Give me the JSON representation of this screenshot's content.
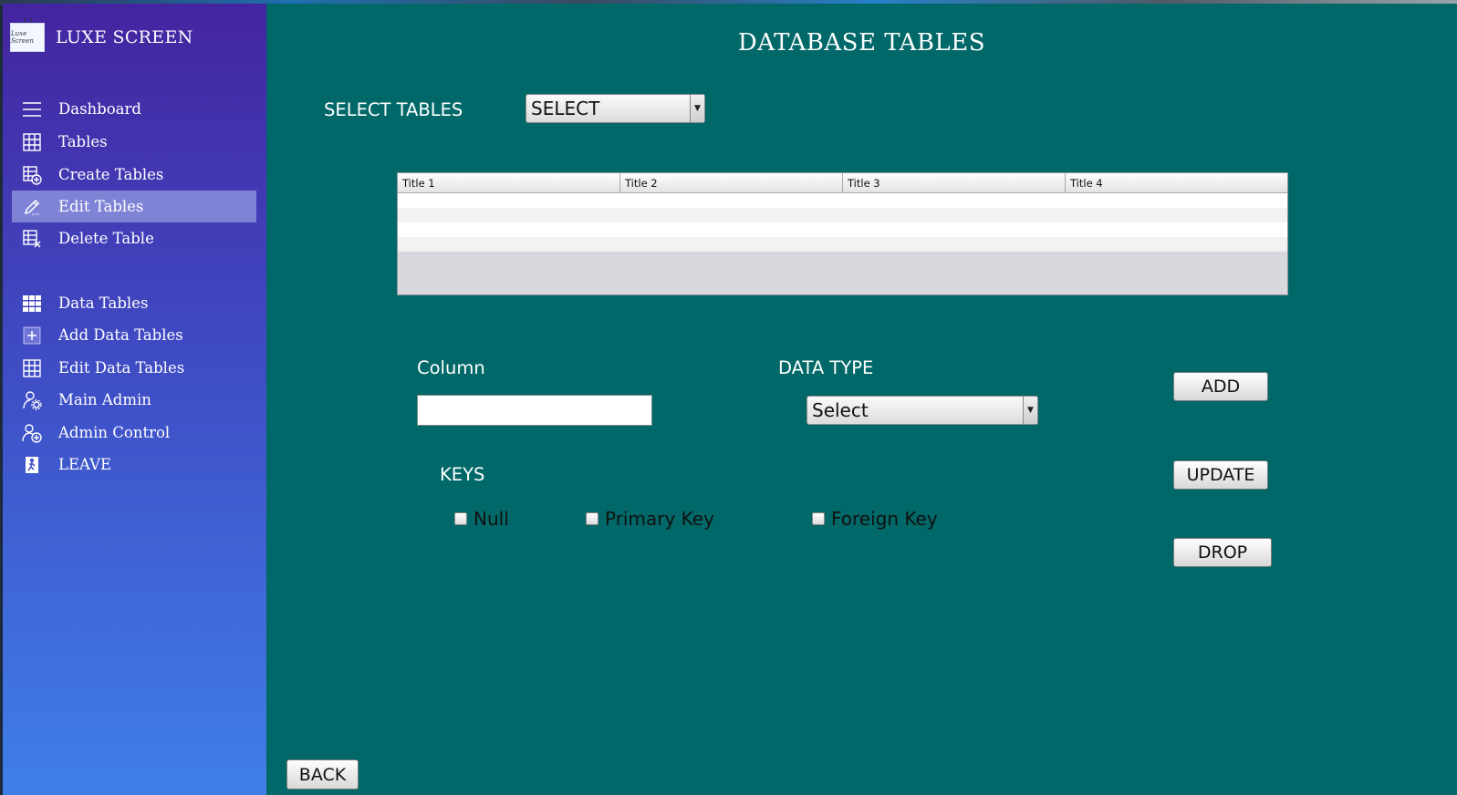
{
  "app": {
    "brand_title": "LUXE SCREEN",
    "brand_logo_text": "Luxe Screen"
  },
  "sidebar": {
    "items": [
      {
        "label": "Dashboard",
        "icon": "menu-icon"
      },
      {
        "label": "Tables",
        "icon": "table-grid-icon"
      },
      {
        "label": "Create Tables",
        "icon": "table-add-icon"
      },
      {
        "label": "Edit Tables",
        "icon": "pencil-icon",
        "active": true
      },
      {
        "label": "Delete Table",
        "icon": "table-delete-icon"
      },
      {
        "label": "Data Tables",
        "icon": "data-grid-icon"
      },
      {
        "label": "Add Data Tables",
        "icon": "plus-square-icon"
      },
      {
        "label": "Edit Data Tables",
        "icon": "table-grid-icon"
      },
      {
        "label": "Main Admin",
        "icon": "admin-gear-icon"
      },
      {
        "label": "Admin Control",
        "icon": "admin-add-icon"
      },
      {
        "label": "LEAVE",
        "icon": "exit-icon"
      }
    ]
  },
  "main": {
    "page_title": "DATABASE TABLES",
    "select_tables_label": "SELECT TABLES",
    "select_tables_value": "SELECT",
    "table": {
      "columns": [
        "Title 1",
        "Title 2",
        "Title 3",
        "Title 4"
      ],
      "rows": [
        [
          "",
          "",
          "",
          ""
        ],
        [
          "",
          "",
          "",
          ""
        ],
        [
          "",
          "",
          "",
          ""
        ],
        [
          "",
          "",
          "",
          ""
        ]
      ]
    },
    "column_label": "Column",
    "column_value": "",
    "data_type_label": "DATA TYPE",
    "data_type_value": "Select",
    "keys_label": "KEYS",
    "checkboxes": {
      "null_label": "Null",
      "primary_label": "Primary Key",
      "foreign_label": "Foreign Key"
    },
    "buttons": {
      "add": "ADD",
      "update": "UPDATE",
      "drop": "DROP",
      "back": "BACK"
    }
  },
  "colors": {
    "main_bg": "#006868",
    "sidebar_top": "#4424a0",
    "sidebar_bottom": "#3f7fe8",
    "active_item": "#7f83d6"
  }
}
